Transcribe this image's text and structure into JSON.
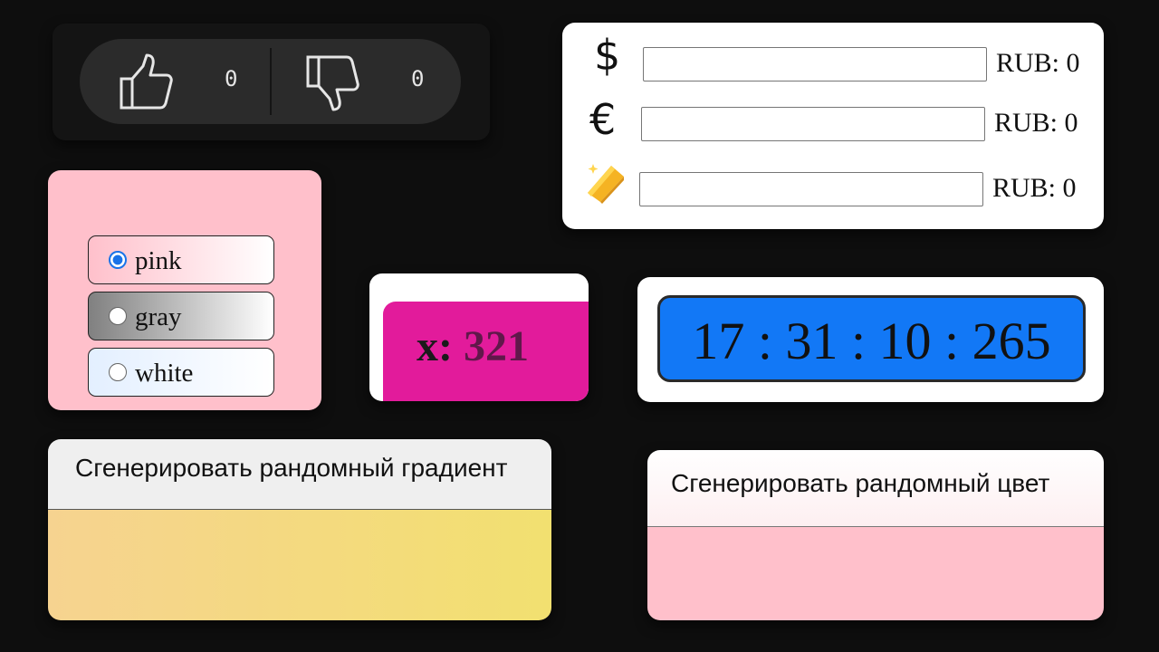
{
  "likes": {
    "like_count": "0",
    "dislike_count": "0"
  },
  "currency": {
    "rows": [
      {
        "symbol": "$",
        "input_value": "",
        "output": "RUB: 0"
      },
      {
        "symbol": "€",
        "input_value": "",
        "output": "RUB: 0"
      },
      {
        "symbol": "gold-bar-icon",
        "input_value": "",
        "output": "RUB: 0"
      }
    ]
  },
  "theme": {
    "options": [
      {
        "label": "pink",
        "checked": true
      },
      {
        "label": "gray",
        "checked": false
      },
      {
        "label": "white",
        "checked": false
      }
    ]
  },
  "coord": {
    "label": "x:",
    "value": "321"
  },
  "clock": {
    "time": "17 : 31 : 10 : 265"
  },
  "gradient_gen": {
    "button_label": "Сгенерировать рандомный градиент",
    "colors": [
      "#f6d390",
      "#f2e070"
    ]
  },
  "color_gen": {
    "button_label": "Сгенерировать рандомный цвет",
    "color": "#ffc0cb"
  },
  "colors": {
    "accent_blue": "#1278f6",
    "magenta": "#e21b9b",
    "pink": "#ffc0cb"
  }
}
